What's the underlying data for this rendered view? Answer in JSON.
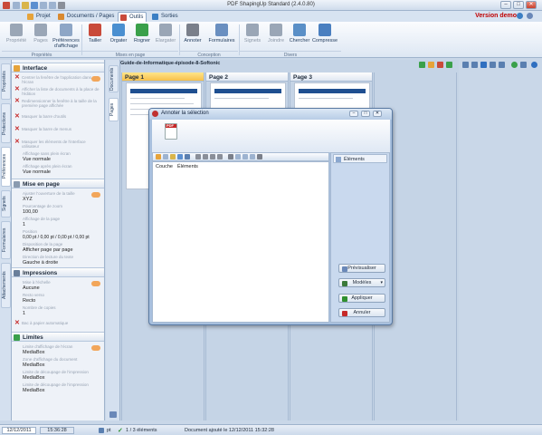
{
  "window": {
    "title": "PDF ShapingUp Standard (2.4.0.80)",
    "minimize": "–",
    "maximize": "□",
    "close": "✕"
  },
  "tabs": [
    {
      "label": "Projet",
      "color": "#e6a33a"
    },
    {
      "label": "Documents / Pages",
      "color": "#d9892f"
    },
    {
      "label": "Outils",
      "color": "#c94a3a",
      "active": true
    },
    {
      "label": "Sorties",
      "color": "#3b7fc4"
    }
  ],
  "demo_label": "Version demo",
  "ribbon": {
    "buttons": [
      {
        "label": "Propriété",
        "color": "#9aa6b6",
        "disabled": true
      },
      {
        "label": "Pages",
        "color": "#9aa6b6",
        "disabled": true
      },
      {
        "label": "Préférences d'affichage",
        "color": "#8ea6c6"
      },
      {
        "label": "Tailler",
        "color": "#c94a3a"
      },
      {
        "label": "Orgater",
        "color": "#4a8fd0"
      },
      {
        "label": "Rogner",
        "color": "#3aa04a"
      },
      {
        "label": "Elargater",
        "color": "#9aa6b6",
        "disabled": true
      },
      {
        "label": "Annoter",
        "color": "#7a7f8a"
      },
      {
        "label": "Formulaires",
        "color": "#6a8fc0"
      },
      {
        "label": "Signets",
        "color": "#9aa6b6",
        "disabled": true
      },
      {
        "label": "Joindre",
        "color": "#9aa6b6",
        "disabled": true
      },
      {
        "label": "Chercher",
        "color": "#5a8fc7"
      },
      {
        "label": "Compresse",
        "color": "#4a7fc0"
      }
    ],
    "groups": [
      "Propriétés",
      "Mises en page",
      "Conception",
      "Divers"
    ]
  },
  "left_tabs": [
    "Propriétés",
    "Protections",
    "Préférences",
    "Signets",
    "Formulaires",
    "Attachements"
  ],
  "panel": {
    "interface": {
      "title": "Interface",
      "rows": [
        "Centrer la fenêtre de l'application dans l'écran",
        "Afficher la liste de documents à la place de l'édition",
        "Redimensionner la fenêtre à la taille de la première page affichée",
        "Masquer la barre d'outils",
        "Masquer la barre de menus",
        "Masquer les éléments de l'interface utilisateur"
      ],
      "fields": [
        {
          "label": "Affichage sans plein écran",
          "value": "Vue normale"
        },
        {
          "label": "Affichage après plein écran",
          "value": "Vue normale"
        }
      ]
    },
    "layout": {
      "title": "Mise en page",
      "fields": [
        {
          "label": "Ajuster l'ouverture de la taille",
          "value": "XYZ"
        },
        {
          "label": "Pourcentage de zoom",
          "value": "100,00"
        },
        {
          "label": "Affichage de la page",
          "value": "1"
        },
        {
          "label": "Position",
          "value": "0,00 pt / 0,00 pt / 0,00 pt / 0,00 pt"
        },
        {
          "label": "Disposition de la page",
          "value": "Afficher page par page"
        },
        {
          "label": "Direction de lecture du texte",
          "value": "Gauche à droite"
        }
      ]
    },
    "print": {
      "title": "Impressions",
      "fields": [
        {
          "label": "Mise à l'échelle",
          "value": "Aucune"
        },
        {
          "label": "Recto verso",
          "value": "Recto"
        },
        {
          "label": "Nombre de copies",
          "value": "1"
        }
      ],
      "row": "Bac à papier automatique"
    },
    "limits": {
      "title": "Limites",
      "fields": [
        {
          "label": "Limite d'affichage de l'écran",
          "value": "MediaBox"
        },
        {
          "label": "Zone d'affichage du document",
          "value": "MediaBox"
        },
        {
          "label": "Limite de découpage de l'impression",
          "value": "MediaBox"
        },
        {
          "label": "Limite de découpage de l'impression",
          "value": "MediaBox"
        }
      ]
    }
  },
  "mid_tabs": [
    "Documents",
    "Pages"
  ],
  "document_title": "Guide-de-Informatique-épisode-8-Softonic",
  "pages": [
    {
      "label": "Page 1",
      "selected": true
    },
    {
      "label": "Page 2"
    },
    {
      "label": "Page 3"
    }
  ],
  "dialog": {
    "title": "Annoter la sélection",
    "icon_text": "PDF",
    "columns": [
      "Couche",
      "Éléments"
    ],
    "tab_label": "Éléments",
    "buttons": [
      {
        "label": "Prévisualiser",
        "color": "#6a88b8"
      },
      {
        "label": "Modèles",
        "color": "#3a7a3a",
        "dropdown": "▾"
      },
      {
        "label": "Appliquer",
        "color": "#2f8f2f"
      },
      {
        "label": "Annuler",
        "color": "#c62828"
      }
    ]
  },
  "status": {
    "date": "12/12/2011",
    "time": "15:36:28",
    "unit": "pt",
    "selection": "1 / 3 éléments",
    "message": "Document ajouté le 12/12/2011 15:32:28"
  }
}
